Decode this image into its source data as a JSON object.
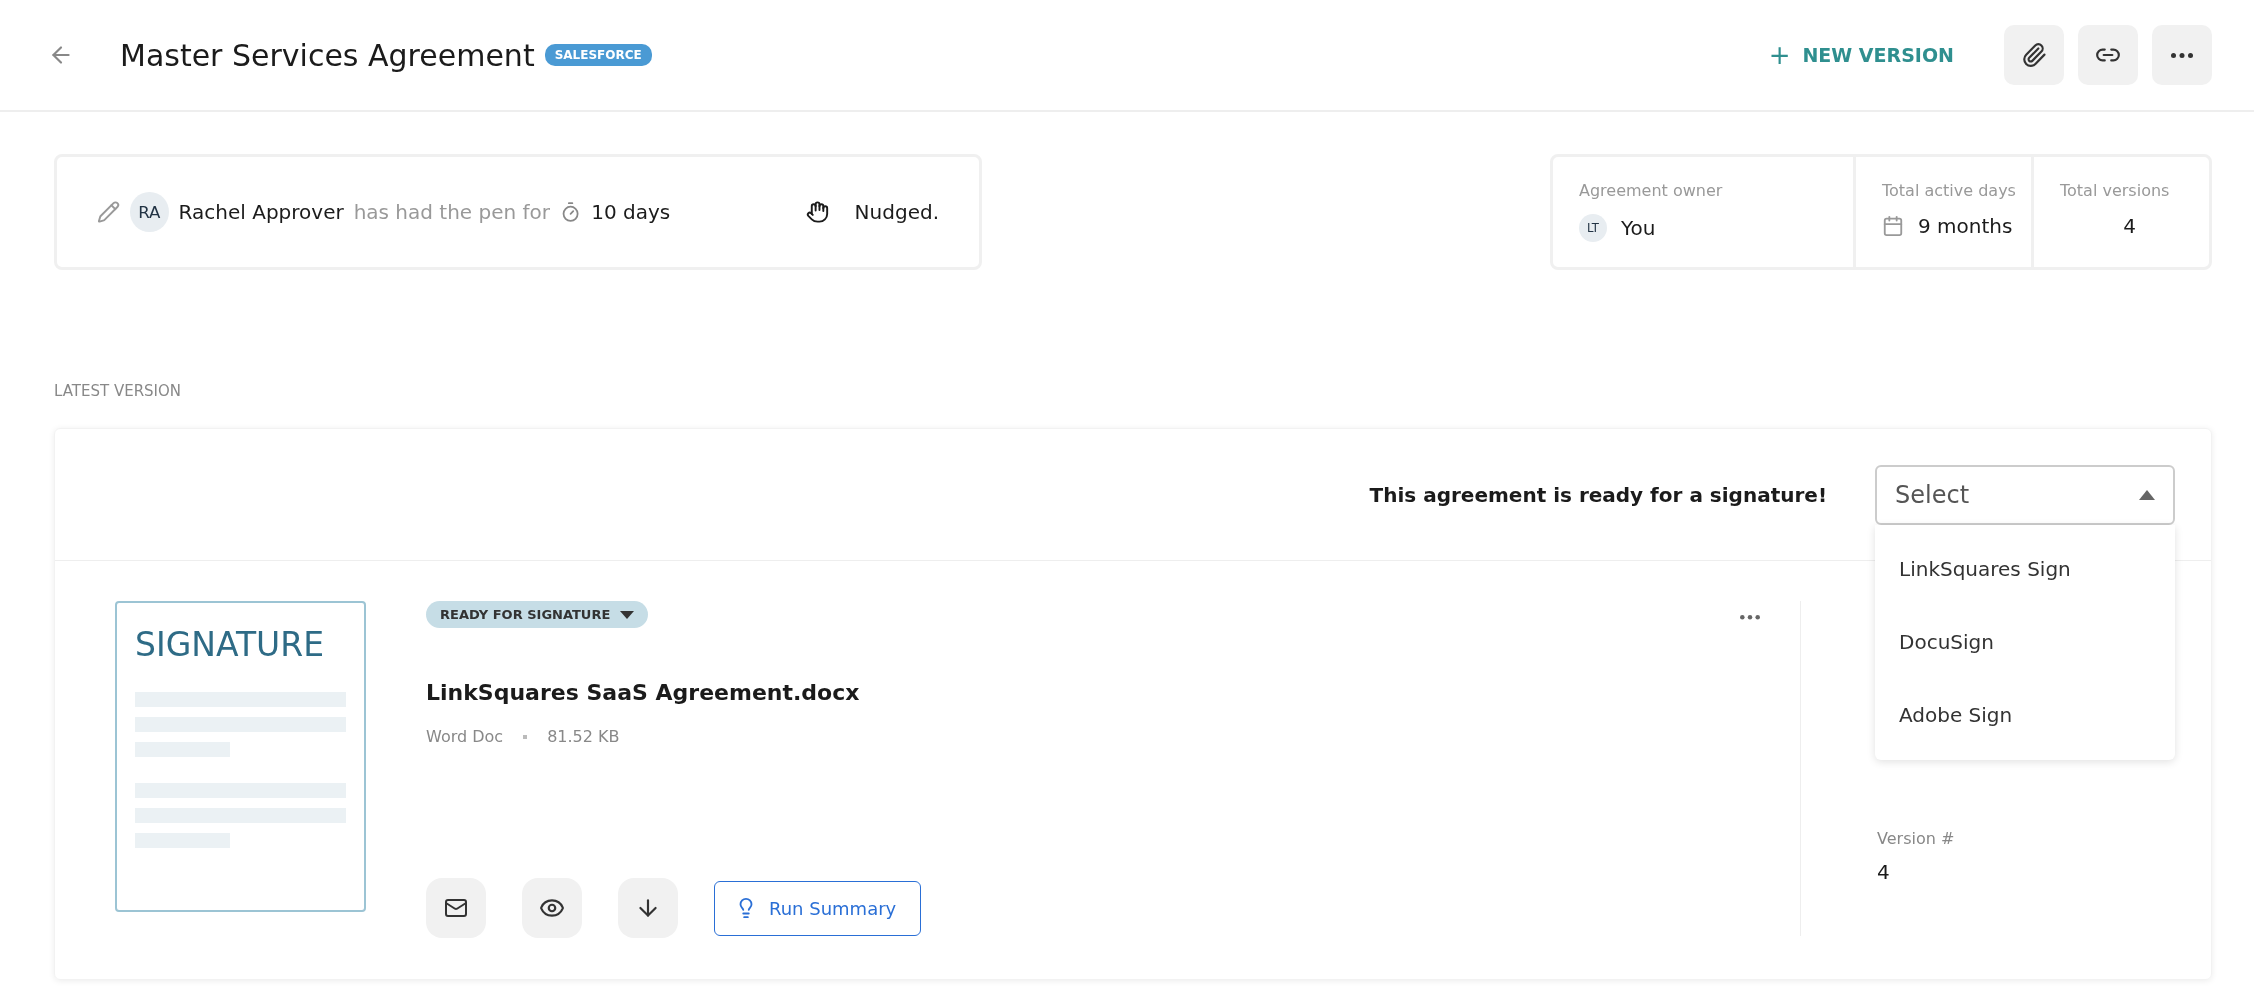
{
  "header": {
    "title": "Master Services Agreement",
    "badge": "SALESFORCE",
    "new_version": "+",
    "new_version_label": "NEW VERSION"
  },
  "pen": {
    "initials": "RA",
    "name": "Rachel Approver",
    "text": "has had the pen for",
    "duration": "10 days",
    "nudge": "Nudged."
  },
  "stats": [
    {
      "kind": "owner",
      "label": "Agreement owner",
      "initials": "LT",
      "value": "You"
    },
    {
      "kind": "days",
      "label": "Total active days",
      "value": "9 months"
    },
    {
      "kind": "plain",
      "label": "Total versions",
      "value": "4"
    }
  ],
  "section_title": "LATEST VERSION",
  "signature": {
    "message": "This agreement is ready for a signature!",
    "select": {
      "placeholder": "Select",
      "expanded": true,
      "options": [
        "LinkSquares Sign",
        "DocuSign",
        "Adobe Sign"
      ]
    }
  },
  "version": {
    "thumbnail_title": "SIGNATURE",
    "status": "READY FOR SIGNATURE",
    "file_name": "LinkSquares SaaS Agreement.docx",
    "file_type": "Word Doc",
    "file_size": "81.52 KB",
    "run_summary": "Run Summary",
    "version_label": "Version #",
    "version_value": "4"
  }
}
